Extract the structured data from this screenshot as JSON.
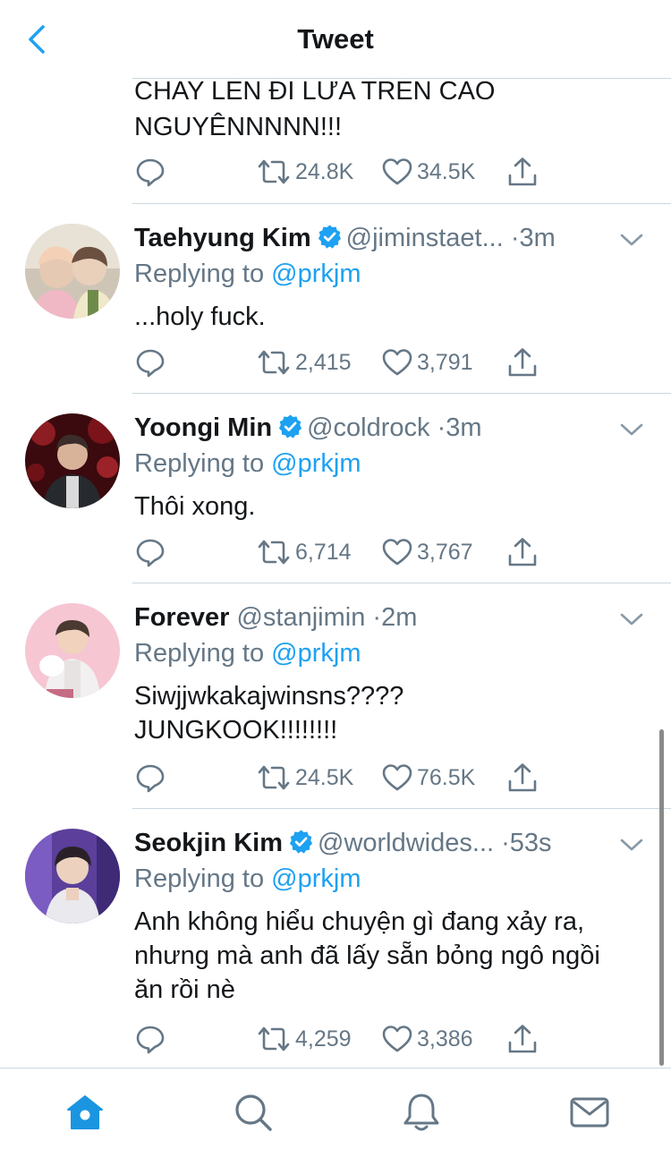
{
  "header": {
    "title": "Tweet"
  },
  "top_tweet": {
    "text": "CHAY LEN ĐI LƯA TREN CAO\nNGUYÊNNNNN!!!",
    "retweets": "24.8K",
    "likes": "34.5K"
  },
  "tweets": [
    {
      "display_name": "Taehyung Kim",
      "verified": true,
      "handle": "@jiminstaet...",
      "time": "3m",
      "replying_prefix": "Replying to",
      "replying_to": "@prkjm",
      "text": "...holy fuck.",
      "retweets": "2,415",
      "likes": "3,791"
    },
    {
      "display_name": "Yoongi Min",
      "verified": true,
      "handle": "@coldrock",
      "time": "3m",
      "replying_prefix": "Replying to",
      "replying_to": "@prkjm",
      "text": "Thôi xong.",
      "retweets": "6,714",
      "likes": "3,767"
    },
    {
      "display_name": "Forever",
      "verified": false,
      "handle": "@stanjimin",
      "time": "2m",
      "replying_prefix": "Replying to",
      "replying_to": "@prkjm",
      "text": "Siwjjwkakajwinsns????\nJUNGKOOK!!!!!!!!",
      "retweets": "24.5K",
      "likes": "76.5K"
    },
    {
      "display_name": "Seokjin Kim",
      "verified": true,
      "handle": "@worldwides...",
      "time": "53s",
      "replying_prefix": "Replying to",
      "replying_to": "@prkjm",
      "text": "Anh không hiểu chuyện gì đang xảy ra,\nnhưng mà anh đã lấy sẵn bỏng ngô ngồi\năn rồi nè",
      "retweets": "4,259",
      "likes": "3,386"
    }
  ],
  "sep": "·",
  "colors": {
    "accent": "#1da1f2",
    "secondary_text": "#657786",
    "divider": "#ccd6dd",
    "nav_active": "#1b95e0"
  },
  "icons": {
    "back": "chevron-left-icon",
    "reply": "reply-icon",
    "retweet": "retweet-icon",
    "like": "heart-icon",
    "share": "share-icon",
    "verified": "verified-badge-icon",
    "more": "chevron-down-icon",
    "nav": [
      "home-icon",
      "search-icon",
      "notifications-icon",
      "messages-icon"
    ]
  }
}
